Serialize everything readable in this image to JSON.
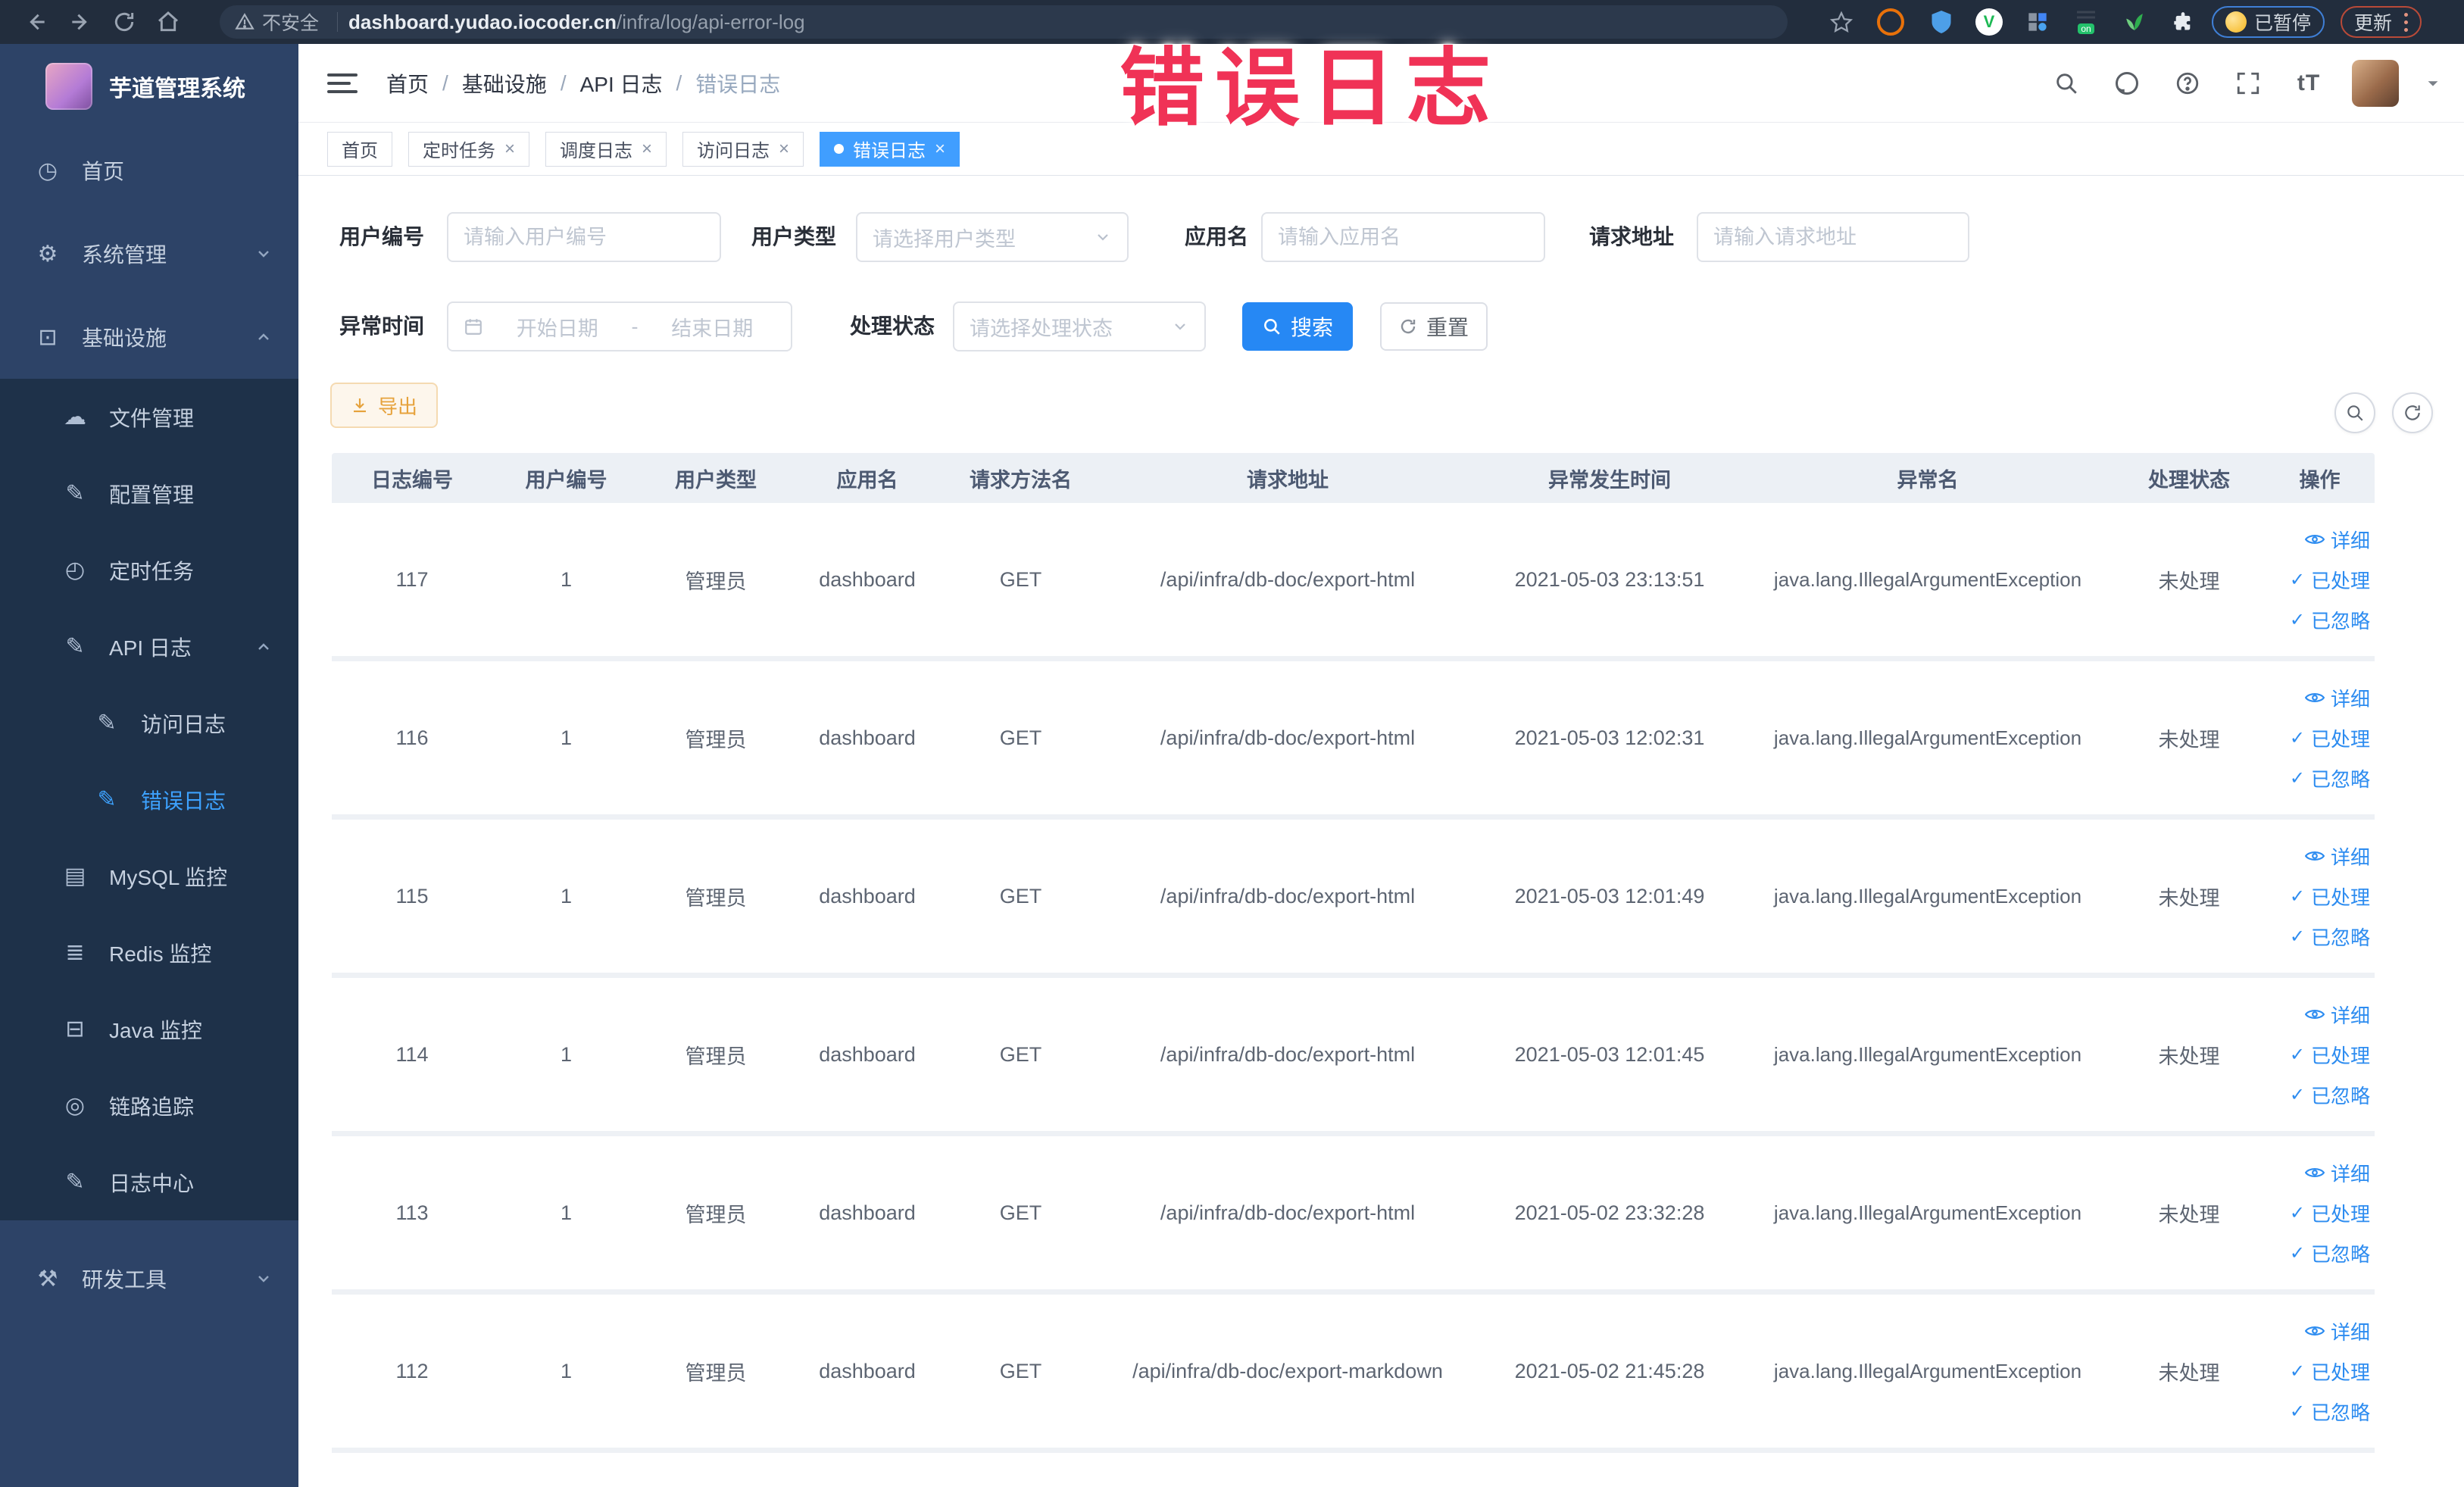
{
  "browser": {
    "security_label": "不安全",
    "url_host": "dashboard.yudao.iocoder.cn",
    "url_path": "/infra/log/api-error-log",
    "paused_button": "已暂停",
    "update_button": "更新"
  },
  "annotation": {
    "text": "错误日志",
    "color": "#f03256"
  },
  "colors": {
    "accent_blue": "#409eff",
    "button_blue": "#2688f4",
    "warning_orange": "#e6a23c",
    "sidebar_bg": "#2d4367",
    "sidebar_submenu_bg": "#1e3149",
    "table_header_bg": "#ecf0f5",
    "annotation_red": "#f03256"
  },
  "sidebar": {
    "title": "芋道管理系统",
    "items": [
      {
        "label": "首页",
        "glyph": "◷"
      },
      {
        "label": "系统管理",
        "glyph": "⚙"
      },
      {
        "label": "基础设施",
        "glyph": "⊡"
      },
      {
        "label": "文件管理",
        "glyph": "☁"
      },
      {
        "label": "配置管理",
        "glyph": "✎"
      },
      {
        "label": "定时任务",
        "glyph": "◴"
      },
      {
        "label": "API 日志",
        "glyph": "✎"
      },
      {
        "label": "访问日志",
        "glyph": "✎"
      },
      {
        "label": "错误日志",
        "glyph": "✎"
      },
      {
        "label": "MySQL 监控",
        "glyph": "▤"
      },
      {
        "label": "Redis 监控",
        "glyph": "≣"
      },
      {
        "label": "Java 监控",
        "glyph": "⊟"
      },
      {
        "label": "链路追踪",
        "glyph": "◎"
      },
      {
        "label": "日志中心",
        "glyph": "✎"
      },
      {
        "label": "研发工具",
        "glyph": "⚒"
      }
    ]
  },
  "breadcrumb": {
    "items": [
      "首页",
      "基础设施",
      "API 日志",
      "错误日志"
    ]
  },
  "tabs": [
    {
      "label": "首页"
    },
    {
      "label": "定时任务"
    },
    {
      "label": "调度日志"
    },
    {
      "label": "访问日志"
    },
    {
      "label": "错误日志"
    }
  ],
  "filters": {
    "user_id": {
      "label": "用户编号",
      "placeholder": "请输入用户编号"
    },
    "user_type": {
      "label": "用户类型",
      "placeholder": "请选择用户类型"
    },
    "app_name": {
      "label": "应用名",
      "placeholder": "请输入应用名"
    },
    "request_url": {
      "label": "请求地址",
      "placeholder": "请输入请求地址"
    },
    "exception_time": {
      "label": "异常时间",
      "start_placeholder": "开始日期",
      "separator": "-",
      "end_placeholder": "结束日期"
    },
    "process_status": {
      "label": "处理状态",
      "placeholder": "请选择处理状态"
    },
    "search_button": "搜索",
    "reset_button": "重置"
  },
  "toolbar": {
    "export_button": "导出"
  },
  "table": {
    "columns": [
      "日志编号",
      "用户编号",
      "用户类型",
      "应用名",
      "请求方法名",
      "请求地址",
      "异常发生时间",
      "异常名",
      "处理状态",
      "操作"
    ],
    "row_actions": {
      "detail": "详细",
      "processed": "已处理",
      "ignored": "已忽略"
    },
    "rows": [
      {
        "id": "117",
        "user_id": "1",
        "user_type": "管理员",
        "app": "dashboard",
        "method": "GET",
        "url": "/api/infra/db-doc/export-html",
        "time": "2021-05-03 23:13:51",
        "exception": "java.lang.IllegalArgumentException",
        "status": "未处理"
      },
      {
        "id": "116",
        "user_id": "1",
        "user_type": "管理员",
        "app": "dashboard",
        "method": "GET",
        "url": "/api/infra/db-doc/export-html",
        "time": "2021-05-03 12:02:31",
        "exception": "java.lang.IllegalArgumentException",
        "status": "未处理"
      },
      {
        "id": "115",
        "user_id": "1",
        "user_type": "管理员",
        "app": "dashboard",
        "method": "GET",
        "url": "/api/infra/db-doc/export-html",
        "time": "2021-05-03 12:01:49",
        "exception": "java.lang.IllegalArgumentException",
        "status": "未处理"
      },
      {
        "id": "114",
        "user_id": "1",
        "user_type": "管理员",
        "app": "dashboard",
        "method": "GET",
        "url": "/api/infra/db-doc/export-html",
        "time": "2021-05-03 12:01:45",
        "exception": "java.lang.IllegalArgumentException",
        "status": "未处理"
      },
      {
        "id": "113",
        "user_id": "1",
        "user_type": "管理员",
        "app": "dashboard",
        "method": "GET",
        "url": "/api/infra/db-doc/export-html",
        "time": "2021-05-02 23:32:28",
        "exception": "java.lang.IllegalArgumentException",
        "status": "未处理"
      },
      {
        "id": "112",
        "user_id": "1",
        "user_type": "管理员",
        "app": "dashboard",
        "method": "GET",
        "url": "/api/infra/db-doc/export-markdown",
        "time": "2021-05-02 21:45:28",
        "exception": "java.lang.IllegalArgumentException",
        "status": "未处理"
      }
    ]
  }
}
